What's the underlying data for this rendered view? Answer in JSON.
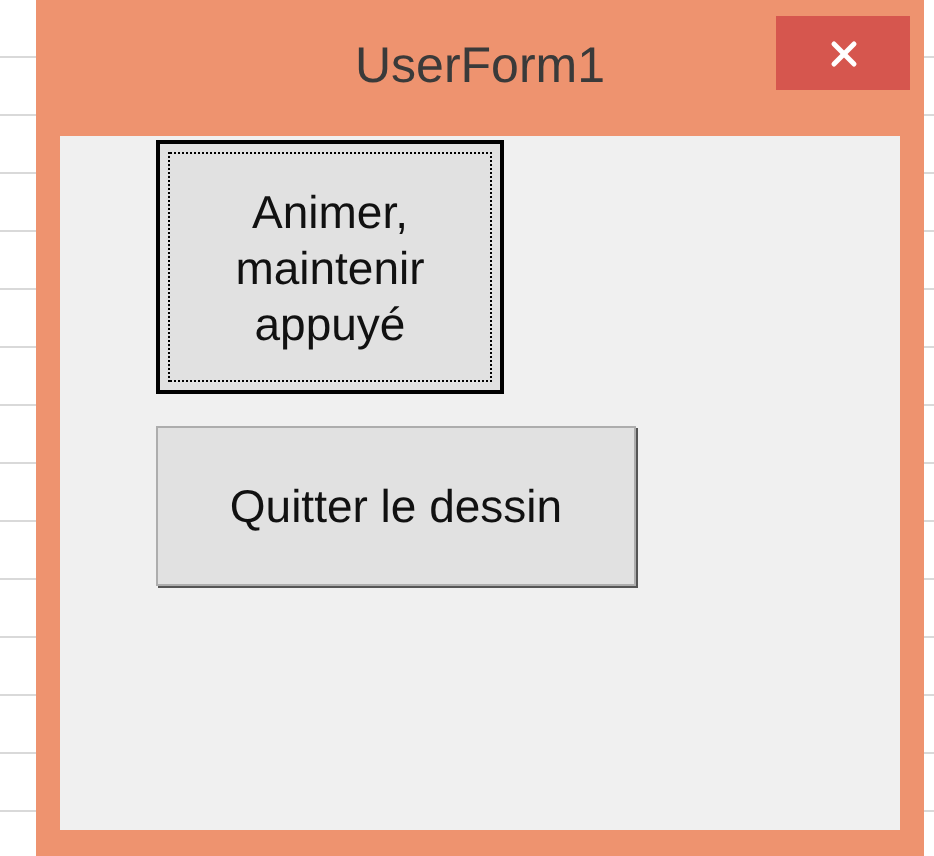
{
  "window": {
    "title": "UserForm1"
  },
  "buttons": [
    {
      "label": "Animer,\nmaintenir\nappuyé",
      "focused": true
    },
    {
      "label": "Quitter le dessin",
      "focused": false
    }
  ]
}
